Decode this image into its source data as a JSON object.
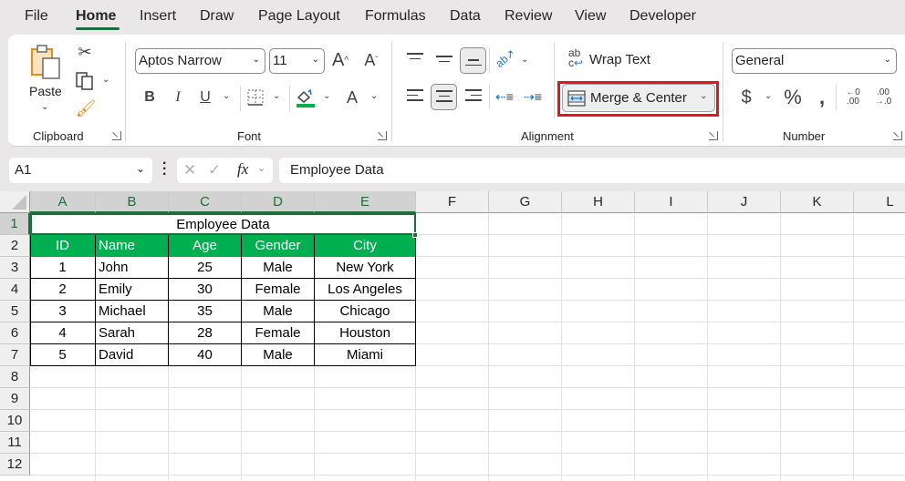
{
  "tabs": [
    {
      "label": "File",
      "active": false
    },
    {
      "label": "Home",
      "active": true
    },
    {
      "label": "Insert",
      "active": false
    },
    {
      "label": "Draw",
      "active": false
    },
    {
      "label": "Page Layout",
      "active": false
    },
    {
      "label": "Formulas",
      "active": false
    },
    {
      "label": "Data",
      "active": false
    },
    {
      "label": "Review",
      "active": false
    },
    {
      "label": "View",
      "active": false
    },
    {
      "label": "Developer",
      "active": false
    }
  ],
  "ribbon": {
    "clipboard": {
      "label": "Clipboard",
      "paste_label": "Paste"
    },
    "font": {
      "label": "Font",
      "font_name": "Aptos Narrow",
      "font_size": "11",
      "bold": "B",
      "italic": "I",
      "underline": "U",
      "font_color_glyph": "A",
      "grow_glyph": "A",
      "shrink_glyph": "A",
      "fill_color": "#00b050"
    },
    "alignment": {
      "label": "Alignment",
      "wrap_text": "Wrap Text",
      "merge_center": "Merge & Center",
      "highlight_color": "#e5141e"
    },
    "number": {
      "label": "Number",
      "format": "General",
      "currency": "$",
      "percent": "%",
      "comma": "❟",
      "inc_decimal": ".00",
      "dec_decimal": ".0"
    }
  },
  "formula_bar": {
    "name_box": "A1",
    "fx": "fx",
    "formula": "Employee Data"
  },
  "sheet": {
    "columns": [
      "A",
      "B",
      "C",
      "D",
      "E",
      "F",
      "G",
      "H",
      "I",
      "J",
      "K",
      "L"
    ],
    "rows": [
      "1",
      "2",
      "3",
      "4",
      "5",
      "6",
      "7",
      "8",
      "9",
      "10",
      "11",
      "12"
    ],
    "title": "Employee Data",
    "header_color": "#00b050",
    "headers": [
      "ID",
      "Name",
      "Age",
      "Gender",
      "City"
    ],
    "data": [
      [
        "1",
        "John",
        "25",
        "Male",
        "New York"
      ],
      [
        "2",
        "Emily",
        "30",
        "Female",
        "Los Angeles"
      ],
      [
        "3",
        "Michael",
        "35",
        "Male",
        "Chicago"
      ],
      [
        "4",
        "Sarah",
        "28",
        "Female",
        "Houston"
      ],
      [
        "5",
        "David",
        "40",
        "Male",
        "Miami"
      ]
    ]
  }
}
